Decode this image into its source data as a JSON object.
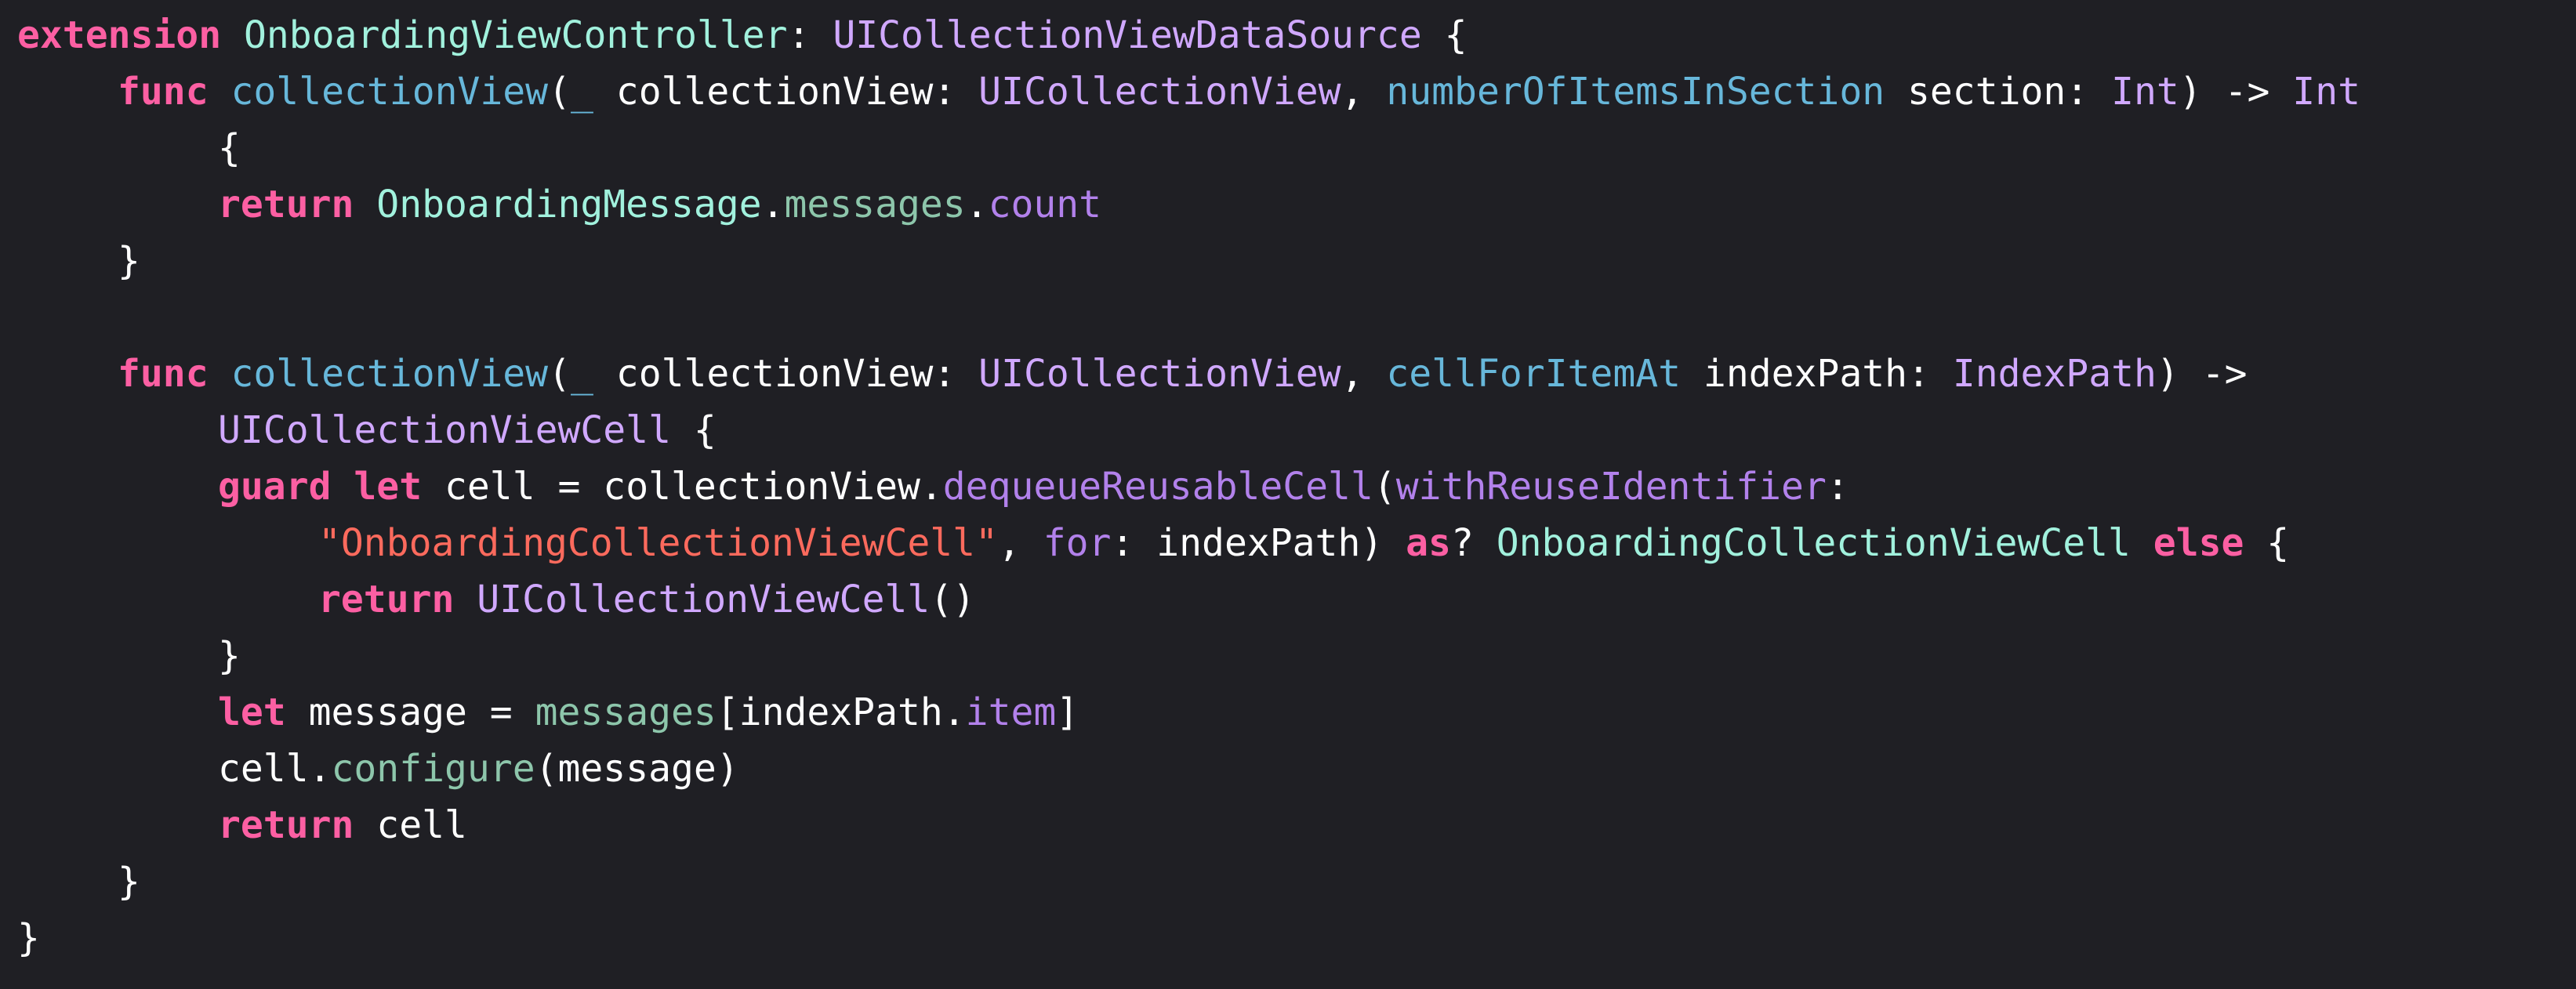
{
  "editor": {
    "background": "#1f1f24",
    "colors": {
      "keyword": "#fc5fa3",
      "type": "#d0a8ff",
      "project_type": "#a1f1dd",
      "function": "#67b7da",
      "project_member": "#8dc6ab",
      "system_member": "#b281eb",
      "string": "#fc6a5d",
      "plain": "#ffffff"
    },
    "lines": [
      {
        "indent": 0,
        "tokens": [
          {
            "t": "kw",
            "v": "extension"
          },
          {
            "t": "plain",
            "v": " "
          },
          {
            "t": "ptype",
            "v": "OnboardingViewController"
          },
          {
            "t": "plain",
            "v": ": "
          },
          {
            "t": "type",
            "v": "UICollectionViewDataSource"
          },
          {
            "t": "plain",
            "v": " {"
          }
        ]
      },
      {
        "indent": 1,
        "tokens": [
          {
            "t": "kw",
            "v": "func"
          },
          {
            "t": "plain",
            "v": " "
          },
          {
            "t": "fn",
            "v": "collectionView"
          },
          {
            "t": "plain",
            "v": "("
          },
          {
            "t": "fn",
            "v": "_"
          },
          {
            "t": "plain",
            "v": " collectionView: "
          },
          {
            "t": "type",
            "v": "UICollectionView"
          },
          {
            "t": "plain",
            "v": ", "
          },
          {
            "t": "fn",
            "v": "numberOfItemsInSection"
          },
          {
            "t": "plain",
            "v": " section: "
          },
          {
            "t": "type",
            "v": "Int"
          },
          {
            "t": "plain",
            "v": ") -> "
          },
          {
            "t": "type",
            "v": "Int"
          }
        ]
      },
      {
        "indent": 2,
        "tokens": [
          {
            "t": "plain",
            "v": "{"
          }
        ]
      },
      {
        "indent": 2,
        "tokens": [
          {
            "t": "kw",
            "v": "return"
          },
          {
            "t": "plain",
            "v": " "
          },
          {
            "t": "ptype",
            "v": "OnboardingMessage"
          },
          {
            "t": "plain",
            "v": "."
          },
          {
            "t": "proj",
            "v": "messages"
          },
          {
            "t": "plain",
            "v": "."
          },
          {
            "t": "sys",
            "v": "count"
          }
        ]
      },
      {
        "indent": 1,
        "tokens": [
          {
            "t": "plain",
            "v": "}"
          }
        ]
      },
      {
        "indent": 0,
        "tokens": []
      },
      {
        "indent": 1,
        "tokens": [
          {
            "t": "kw",
            "v": "func"
          },
          {
            "t": "plain",
            "v": " "
          },
          {
            "t": "fn",
            "v": "collectionView"
          },
          {
            "t": "plain",
            "v": "("
          },
          {
            "t": "fn",
            "v": "_"
          },
          {
            "t": "plain",
            "v": " collectionView: "
          },
          {
            "t": "type",
            "v": "UICollectionView"
          },
          {
            "t": "plain",
            "v": ", "
          },
          {
            "t": "fn",
            "v": "cellForItemAt"
          },
          {
            "t": "plain",
            "v": " indexPath: "
          },
          {
            "t": "type",
            "v": "IndexPath"
          },
          {
            "t": "plain",
            "v": ") ->"
          }
        ]
      },
      {
        "indent": 2,
        "tokens": [
          {
            "t": "type",
            "v": "UICollectionViewCell"
          },
          {
            "t": "plain",
            "v": " {"
          }
        ]
      },
      {
        "indent": 2,
        "tokens": [
          {
            "t": "kw",
            "v": "guard"
          },
          {
            "t": "plain",
            "v": " "
          },
          {
            "t": "kw",
            "v": "let"
          },
          {
            "t": "plain",
            "v": " cell = collectionView."
          },
          {
            "t": "sys",
            "v": "dequeueReusableCell"
          },
          {
            "t": "plain",
            "v": "("
          },
          {
            "t": "sys",
            "v": "withReuseIdentifier"
          },
          {
            "t": "plain",
            "v": ":"
          }
        ]
      },
      {
        "indent": 3,
        "tokens": [
          {
            "t": "str",
            "v": "\"OnboardingCollectionViewCell\""
          },
          {
            "t": "plain",
            "v": ", "
          },
          {
            "t": "sys",
            "v": "for"
          },
          {
            "t": "plain",
            "v": ": indexPath) "
          },
          {
            "t": "kw",
            "v": "as"
          },
          {
            "t": "plain",
            "v": "? "
          },
          {
            "t": "ptype",
            "v": "OnboardingCollectionViewCell"
          },
          {
            "t": "plain",
            "v": " "
          },
          {
            "t": "kw",
            "v": "else"
          },
          {
            "t": "plain",
            "v": " {"
          }
        ]
      },
      {
        "indent": 3,
        "tokens": [
          {
            "t": "kw",
            "v": "return"
          },
          {
            "t": "plain",
            "v": " "
          },
          {
            "t": "type",
            "v": "UICollectionViewCell"
          },
          {
            "t": "plain",
            "v": "()"
          }
        ]
      },
      {
        "indent": 2,
        "tokens": [
          {
            "t": "plain",
            "v": "}"
          }
        ]
      },
      {
        "indent": 2,
        "tokens": [
          {
            "t": "kw",
            "v": "let"
          },
          {
            "t": "plain",
            "v": " message = "
          },
          {
            "t": "proj",
            "v": "messages"
          },
          {
            "t": "plain",
            "v": "[indexPath."
          },
          {
            "t": "sys",
            "v": "item"
          },
          {
            "t": "plain",
            "v": "]"
          }
        ]
      },
      {
        "indent": 2,
        "tokens": [
          {
            "t": "plain",
            "v": "cell."
          },
          {
            "t": "proj",
            "v": "configure"
          },
          {
            "t": "plain",
            "v": "(message)"
          }
        ]
      },
      {
        "indent": 2,
        "tokens": [
          {
            "t": "kw",
            "v": "return"
          },
          {
            "t": "plain",
            "v": " cell"
          }
        ]
      },
      {
        "indent": 1,
        "tokens": [
          {
            "t": "plain",
            "v": "}"
          }
        ]
      },
      {
        "indent": 0,
        "tokens": [
          {
            "t": "plain",
            "v": "}"
          }
        ]
      }
    ]
  }
}
